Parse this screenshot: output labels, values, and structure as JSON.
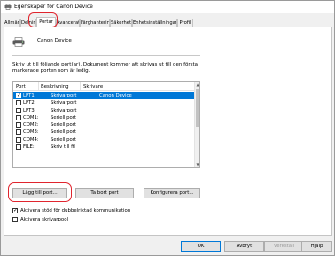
{
  "window": {
    "title": "Egenskaper för Canon Device"
  },
  "tabs": [
    {
      "label": "Allmänt",
      "active": false
    },
    {
      "label": "Delning",
      "active": false
    },
    {
      "label": "Portar",
      "active": true
    },
    {
      "label": "Avancerat",
      "active": false
    },
    {
      "label": "Färghantering",
      "active": false
    },
    {
      "label": "Säkerhet",
      "active": false
    },
    {
      "label": "Enhetsinställningar",
      "active": false
    },
    {
      "label": "Profil",
      "active": false
    }
  ],
  "printer": {
    "name": "Canon Device",
    "icon": "printer-icon"
  },
  "description": "Skriv ut till följande port(ar). Dokument kommer att skrivas ut till den första markerade porten som är ledig.",
  "port_list": {
    "headers": {
      "port": "Port",
      "description": "Beskrivning",
      "printer": "Skrivare"
    },
    "rows": [
      {
        "checked": true,
        "port": "LPT1:",
        "description": "Skrivarport",
        "printer": "Canon Device",
        "selected": true
      },
      {
        "checked": false,
        "port": "LPT2:",
        "description": "Skrivarport",
        "printer": "",
        "selected": false
      },
      {
        "checked": false,
        "port": "LPT3:",
        "description": "Skrivarport",
        "printer": "",
        "selected": false
      },
      {
        "checked": false,
        "port": "COM1:",
        "description": "Seriell port",
        "printer": "",
        "selected": false
      },
      {
        "checked": false,
        "port": "COM2:",
        "description": "Seriell port",
        "printer": "",
        "selected": false
      },
      {
        "checked": false,
        "port": "COM3:",
        "description": "Seriell port",
        "printer": "",
        "selected": false
      },
      {
        "checked": false,
        "port": "COM4:",
        "description": "Seriell port",
        "printer": "",
        "selected": false
      },
      {
        "checked": false,
        "port": "FILE:",
        "description": "Skriv till fil",
        "printer": "",
        "selected": false
      }
    ]
  },
  "buttons": {
    "add_port": "Lägg till port...",
    "remove_port": "Ta bort port",
    "configure_port": "Konfigurera port..."
  },
  "options": {
    "bidirectional": {
      "label": "Aktivera stöd för dubbelriktad kommunikation",
      "checked": true
    },
    "pooling": {
      "label": "Aktivera skrivarpool",
      "checked": false
    }
  },
  "dialog_buttons": {
    "ok": "OK",
    "cancel": "Avbryt",
    "apply": "Verkställ",
    "help": "Hjälp"
  },
  "colors": {
    "highlight": "#e0252e",
    "selection": "#0078d7"
  }
}
